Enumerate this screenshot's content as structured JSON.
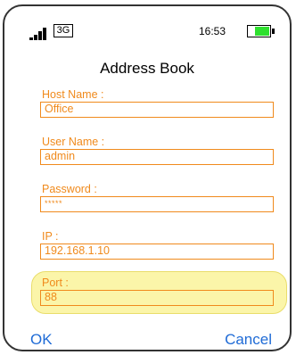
{
  "status_bar": {
    "network": "3G",
    "time": "16:53",
    "signal_icon": "signal-bars-icon",
    "battery_icon": "battery-icon",
    "battery_color": "#2ee02e"
  },
  "screen": {
    "title": "Address Book"
  },
  "fields": {
    "host_name": {
      "label": "Host Name :",
      "value": "Office"
    },
    "user_name": {
      "label": "User Name :",
      "value": "admin"
    },
    "password": {
      "label": "Password :",
      "value": "*****"
    },
    "ip": {
      "label": "IP :",
      "value": "192.168.1.10"
    },
    "port": {
      "label": "Port :",
      "value": "88"
    }
  },
  "softkeys": {
    "ok": "OK",
    "cancel": "Cancel"
  },
  "colors": {
    "field_accent": "#f08a1c",
    "softkey": "#1f6bd6",
    "focus_highlight": "#fbf5a9"
  }
}
